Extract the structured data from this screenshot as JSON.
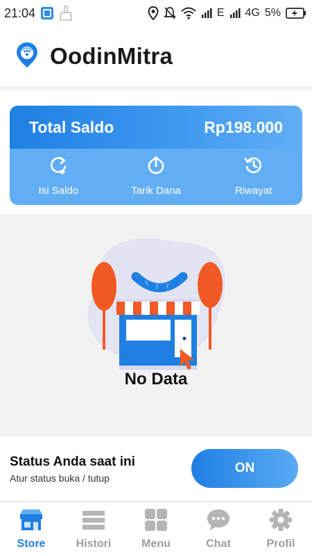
{
  "status_bar": {
    "time": "21:04",
    "network_e": "E",
    "network_4g": "4G",
    "battery": "5%"
  },
  "header": {
    "app_name": "OodinMitra",
    "logo_icon": "location-pin-wifi-icon"
  },
  "balance": {
    "label": "Total Saldo",
    "amount": "Rp198.000",
    "actions": [
      {
        "label": "Isi Saldo",
        "icon": "refresh-plus-icon"
      },
      {
        "label": "Tarik Dana",
        "icon": "withdraw-icon"
      },
      {
        "label": "Riwayat",
        "icon": "history-icon"
      }
    ]
  },
  "empty_state": {
    "text": "No Data",
    "icon": "empty-store-illustration"
  },
  "store_status": {
    "title": "Status Anda saat ini",
    "subtitle": "Atur status buka / tutup",
    "toggle_label": "ON"
  },
  "bottom_nav": {
    "items": [
      {
        "label": "Store",
        "icon": "store-icon",
        "active": true
      },
      {
        "label": "Histori",
        "icon": "list-icon",
        "active": false
      },
      {
        "label": "Menu",
        "icon": "grid-icon",
        "active": false
      },
      {
        "label": "Chat",
        "icon": "chat-bubble-icon",
        "active": false
      },
      {
        "label": "Profil",
        "icon": "gear-icon",
        "active": false
      }
    ]
  },
  "colors": {
    "primary": "#1f7fe3",
    "primary_light": "#62aef5",
    "accent_orange": "#f15a24",
    "nav_inactive": "#9e9e9e"
  }
}
